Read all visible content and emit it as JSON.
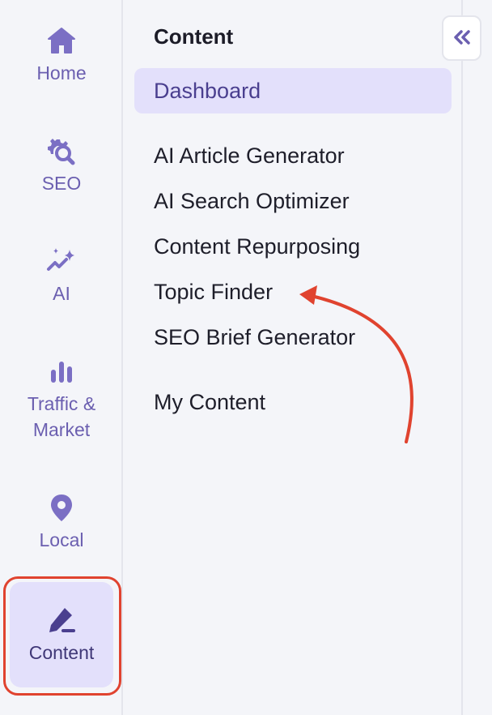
{
  "rail": {
    "items": [
      {
        "label": "Home",
        "icon": "home-icon"
      },
      {
        "label": "SEO",
        "icon": "seo-gear-search-icon"
      },
      {
        "label": "AI",
        "icon": "ai-sparkle-icon"
      },
      {
        "label": "Traffic &\nMarket",
        "icon": "bar-chart-icon"
      },
      {
        "label": "Local",
        "icon": "location-pin-icon"
      },
      {
        "label": "Content",
        "icon": "pencil-icon"
      }
    ],
    "active": "Content"
  },
  "panel": {
    "title": "Content",
    "items": [
      {
        "label": "Dashboard",
        "selected": true
      },
      {
        "label": "AI Article Generator"
      },
      {
        "label": "AI Search Optimizer"
      },
      {
        "label": "Content Repurposing"
      },
      {
        "label": "Topic Finder"
      },
      {
        "label": "SEO Brief Generator"
      },
      {
        "label": "My Content"
      }
    ]
  },
  "collapse_button": {
    "icon": "double-chevron-left-icon"
  },
  "colors": {
    "accent": "#6b5fb0",
    "active_bg": "#e3e0fb",
    "highlight": "#e0432f",
    "background": "#f4f5f9"
  }
}
